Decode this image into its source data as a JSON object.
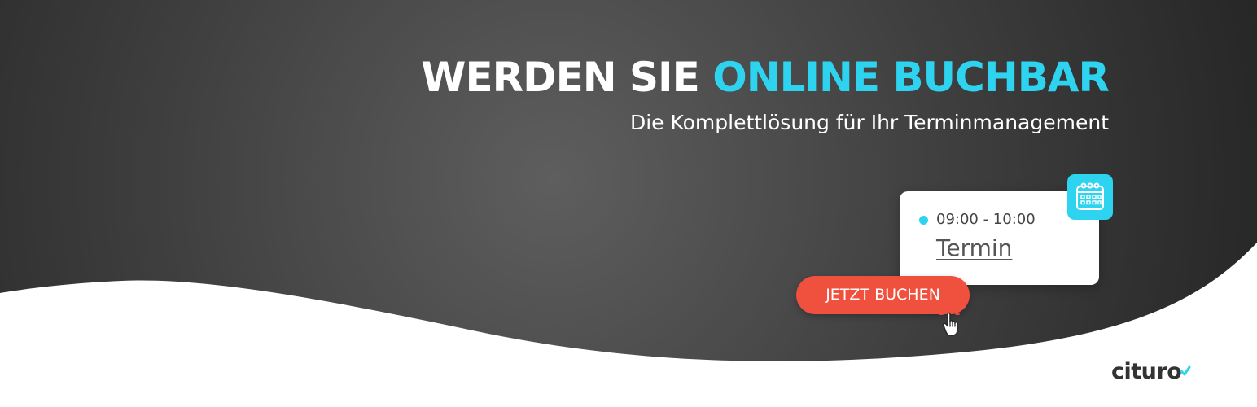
{
  "hero": {
    "title_part1": "WERDEN SIE",
    "title_part2": "ONLINE BUCHBAR",
    "subtitle": "Die Komplettlösung für Ihr Terminmanagement"
  },
  "appointment_card": {
    "time": "09:00 - 10:00",
    "label": "Termin",
    "badge_icon": "calendar-icon"
  },
  "cta": {
    "label": "JETZT BUCHEN",
    "cursor_icon": "hand-pointer-icon"
  },
  "brand": {
    "logo_text": "cituro"
  },
  "colors": {
    "accent": "#2ed3ef",
    "cta": "#f0503e",
    "background_dark": "#3a3a3a",
    "text_light": "#ffffff"
  }
}
